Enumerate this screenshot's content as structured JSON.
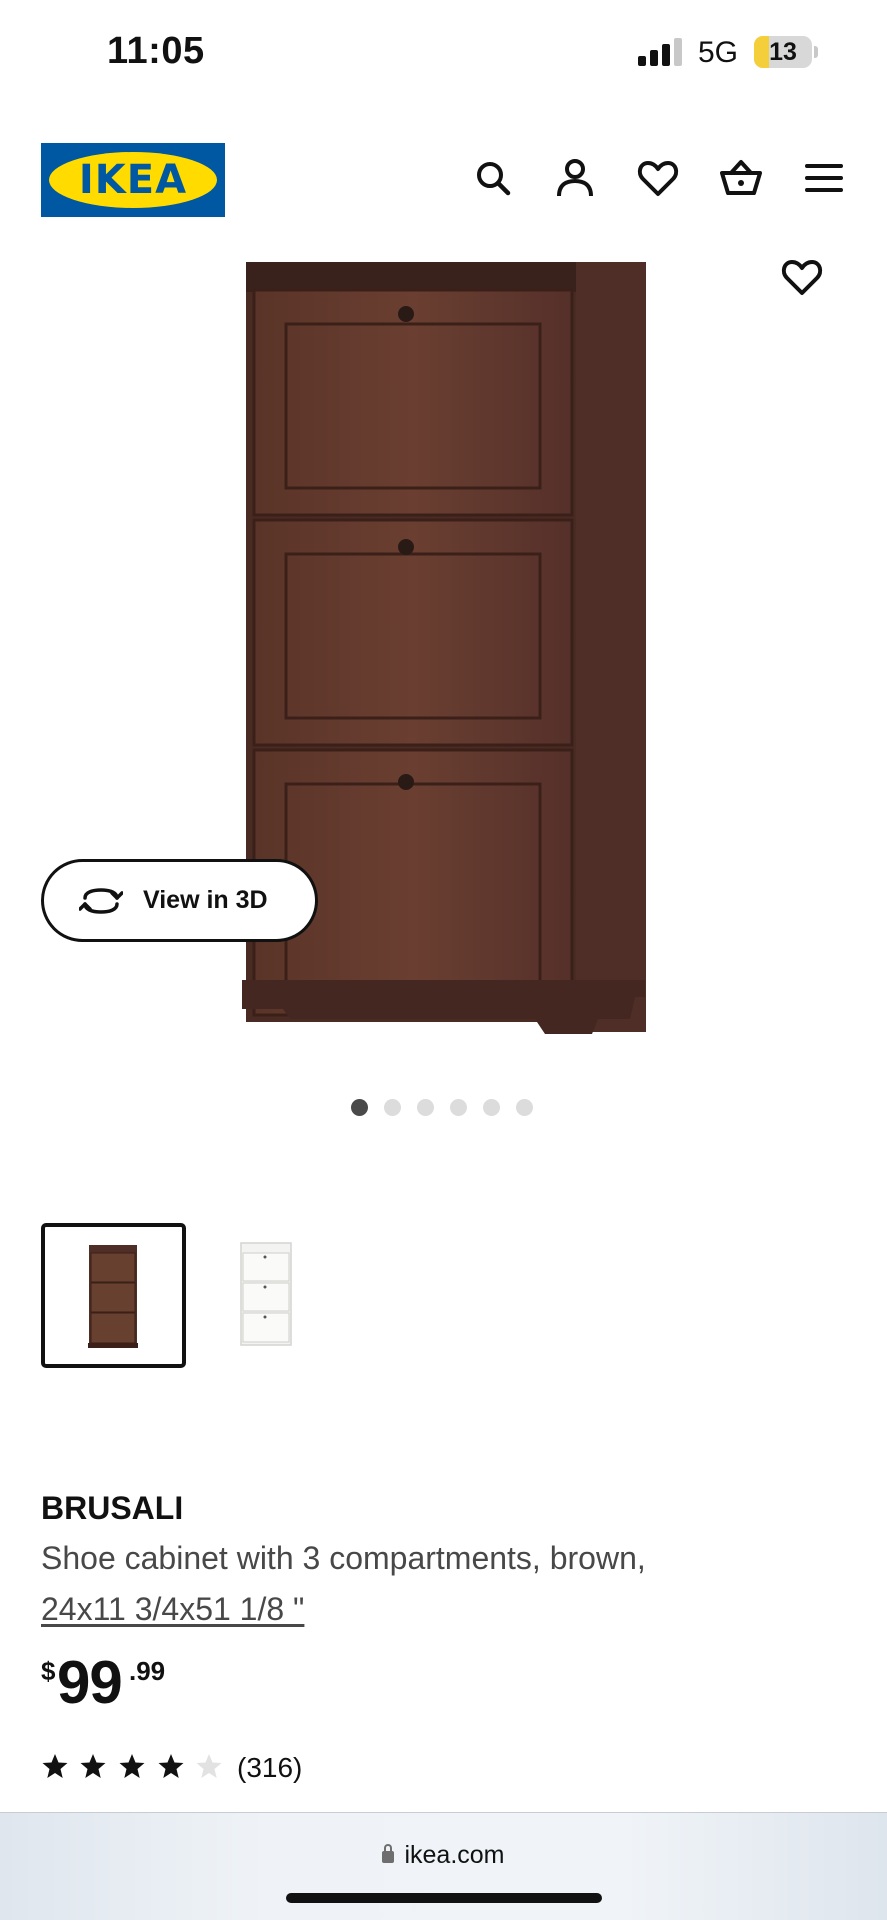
{
  "status_bar": {
    "time": "11:05",
    "network": "5G",
    "battery_level": "13",
    "battery_fraction": 0.25,
    "battery_color": "#f4cf3a"
  },
  "header": {
    "logo_text": "IKEA",
    "brand_blue": "#0058a3",
    "brand_yellow": "#ffdb00",
    "icons": [
      "search-icon",
      "account-icon",
      "favorites-icon",
      "cart-icon",
      "menu-icon"
    ]
  },
  "hero": {
    "view_3d_label": "View in 3D",
    "image_count": 6,
    "active_image": 1,
    "favorite_icon": "heart-icon"
  },
  "thumbnails": [
    {
      "variant": "brown",
      "selected": true
    },
    {
      "variant": "white",
      "selected": false
    }
  ],
  "product": {
    "name": "BRUSALI",
    "description": "Shoe cabinet with 3 compartments, brown,",
    "size": "24x11 3/4x51 1/8 \"",
    "price_currency": "$",
    "price_integer": "99",
    "price_decimal": ".99",
    "rating": 4,
    "rating_max": 5,
    "review_count": "(316)"
  },
  "browser": {
    "url": "ikea.com"
  }
}
